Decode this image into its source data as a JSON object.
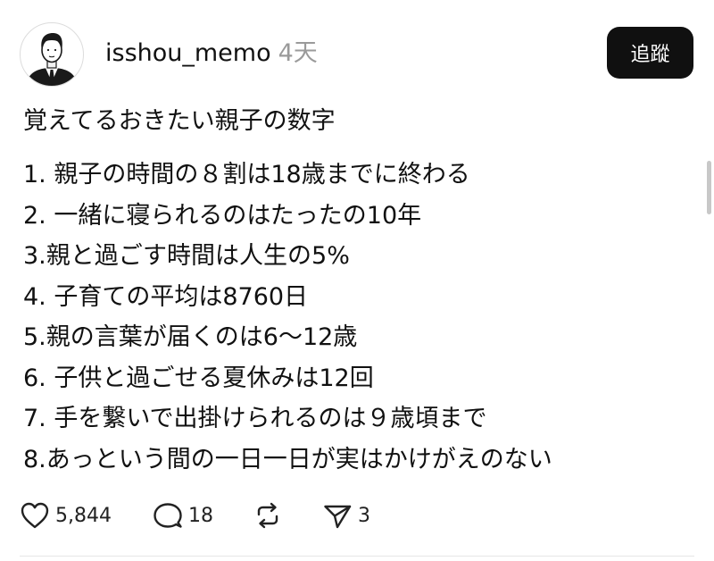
{
  "post": {
    "author": {
      "username": "isshou_memo",
      "timestamp": "4天",
      "avatar_icon": "man-in-suit-avatar"
    },
    "follow_label": "追蹤",
    "title": "覚えてるおきたい親子の数字",
    "items": [
      "1. 親子の時間の８割は18歳までに終わる",
      "2. 一緒に寝られるのはたったの10年",
      "3.親と過ごす時間は人生の5%",
      "4. 子育ての平均は8760日",
      "5.親の言葉が届くのは6〜12歳",
      "6. 子供と過ごせる夏休みは12回",
      "7. 手を繋いで出掛けられるのは９歳頃まで",
      "8.あっという間の一日一日が実はかけがえのない"
    ],
    "stats": {
      "likes": "5,844",
      "replies": "18",
      "shares": "3"
    },
    "icons": {
      "like": "heart-icon",
      "reply": "speech-bubble-icon",
      "repost": "repost-icon",
      "share": "paper-plane-icon"
    }
  },
  "colors": {
    "text": "#111111",
    "muted": "#9a9a9a",
    "button_bg": "#101010",
    "button_text": "#ffffff"
  }
}
